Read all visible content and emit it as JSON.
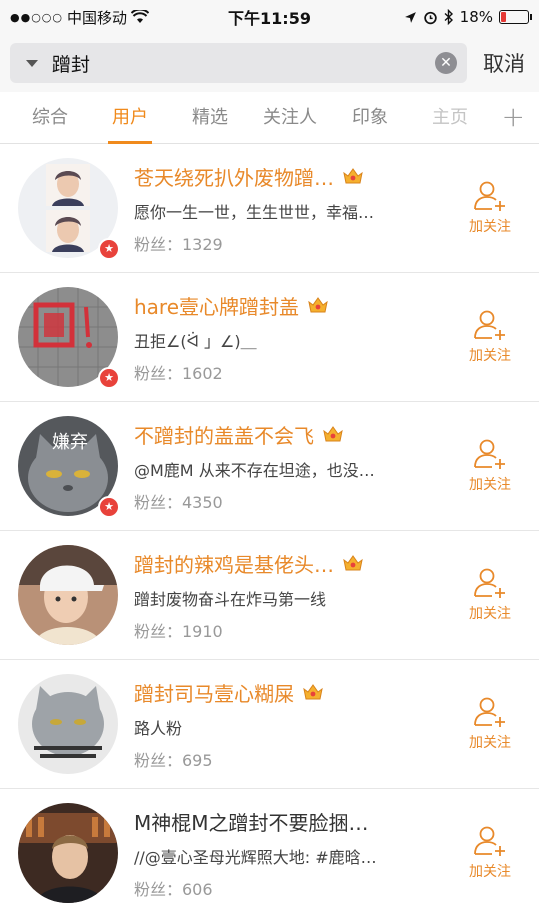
{
  "status_bar": {
    "carrier": "中国移动",
    "time": "下午11:59",
    "battery_percent_label": "18%",
    "battery_level": 0.18
  },
  "search": {
    "query": "蹭封",
    "cancel_label": "取消"
  },
  "tabs": [
    {
      "label": "综合",
      "active": false
    },
    {
      "label": "用户",
      "active": true
    },
    {
      "label": "精选",
      "active": false
    },
    {
      "label": "关注人",
      "active": false
    },
    {
      "label": "印象",
      "active": false
    },
    {
      "label": "主页",
      "active": false
    }
  ],
  "tab_add_label": "+",
  "follow_label": "加关注",
  "colors": {
    "accent": "#f08a1c",
    "name": "#e8892a",
    "vip_badge": "#e8423b"
  },
  "users": [
    {
      "name": "苍天绕死扒外废物蹭…",
      "desc": "愿你一生一世，生生世世，幸福…",
      "fans_label": "粉丝：1329",
      "vip": true,
      "crown": true,
      "name_highlight": true,
      "avatar": "two-boy-portraits"
    },
    {
      "name": "hare壹心牌蹭封盖",
      "desc": "丑拒∠(ᐛ 」∠)＿",
      "fans_label": "粉丝：1602",
      "vip": true,
      "crown": true,
      "name_highlight": true,
      "avatar": "manhole-cover-with-red-character"
    },
    {
      "name": "不蹭封的盖盖不会飞",
      "desc": "@M鹿M 从来不存在坦途，也没…",
      "fans_label": "粉丝：4350",
      "vip": true,
      "crown": true,
      "name_highlight": true,
      "avatar": "grey-cat-with-text",
      "avatar_text": "嫌弃"
    },
    {
      "name": "蹭封的辣鸡是基佬头…",
      "desc": "蹭封废物奋斗在炸马第一线",
      "fans_label": "粉丝：1910",
      "vip": false,
      "crown": true,
      "name_highlight": true,
      "avatar": "boy-in-cap"
    },
    {
      "name": "蹭封司马壹心糊屎",
      "desc": "路人粉",
      "fans_label": "粉丝：695",
      "vip": false,
      "crown": true,
      "name_highlight": true,
      "avatar": "grey-cat-meme"
    },
    {
      "name": "M神棍M之蹭封不要脸捆…",
      "desc": "//@壹心圣母光辉照大地: #鹿晗…",
      "fans_label": "粉丝：606",
      "vip": false,
      "crown": false,
      "name_highlight": false,
      "avatar": "man-in-bar"
    }
  ]
}
